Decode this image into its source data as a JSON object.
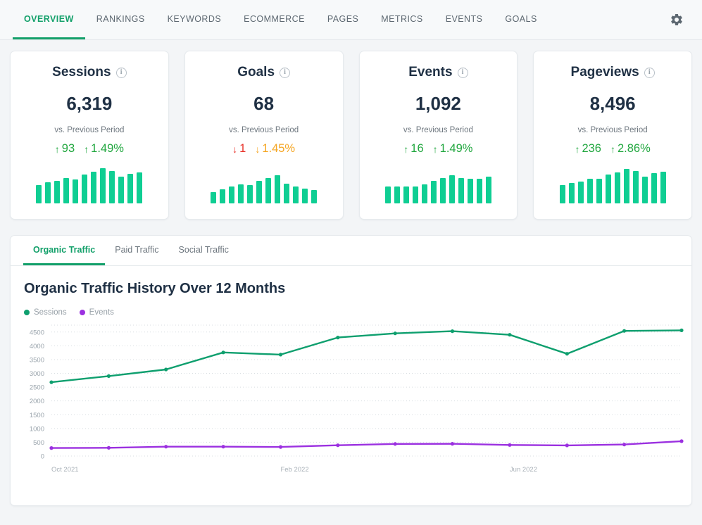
{
  "nav": {
    "tabs": [
      {
        "label": "OVERVIEW",
        "active": true
      },
      {
        "label": "RANKINGS",
        "active": false
      },
      {
        "label": "KEYWORDS",
        "active": false
      },
      {
        "label": "ECOMMERCE",
        "active": false
      },
      {
        "label": "PAGES",
        "active": false
      },
      {
        "label": "METRICS",
        "active": false
      },
      {
        "label": "EVENTS",
        "active": false
      },
      {
        "label": "GOALS",
        "active": false
      }
    ],
    "settings_icon": "gear-icon"
  },
  "colors": {
    "accent_green": "#13a06a",
    "spark_green": "#0fce93",
    "up_green": "#21a73f",
    "down_red": "#e8332a",
    "down_orange": "#f5a623",
    "sessions_line": "#0e9f6e",
    "events_line": "#9b30e0",
    "title": "#1f3044"
  },
  "cards": [
    {
      "title": "Sessions",
      "info_icon": "info-icon",
      "value": "6,319",
      "comparison_label": "vs. Previous Period",
      "delta_abs": {
        "arrow": "up",
        "text": "93",
        "color": "#21a73f"
      },
      "delta_pct": {
        "arrow": "up",
        "text": "1.49%",
        "color": "#21a73f"
      },
      "spark": [
        26,
        30,
        32,
        36,
        34,
        41,
        45,
        50,
        46,
        38,
        42,
        44
      ]
    },
    {
      "title": "Goals",
      "info_icon": "info-icon",
      "value": "68",
      "comparison_label": "vs. Previous Period",
      "delta_abs": {
        "arrow": "down",
        "text": "1",
        "color": "#e8332a"
      },
      "delta_pct": {
        "arrow": "down",
        "text": "1.45%",
        "color": "#f5a623"
      },
      "spark": [
        16,
        20,
        24,
        27,
        26,
        32,
        36,
        40,
        28,
        24,
        21,
        19
      ]
    },
    {
      "title": "Events",
      "info_icon": "info-icon",
      "value": "1,092",
      "comparison_label": "vs. Previous Period",
      "delta_abs": {
        "arrow": "up",
        "text": "16",
        "color": "#21a73f"
      },
      "delta_pct": {
        "arrow": "up",
        "text": "1.49%",
        "color": "#21a73f"
      },
      "spark": [
        24,
        24,
        24,
        24,
        27,
        32,
        36,
        40,
        36,
        35,
        35,
        38
      ]
    },
    {
      "title": "Pageviews",
      "info_icon": "info-icon",
      "value": "8,496",
      "comparison_label": "vs. Previous Period",
      "delta_abs": {
        "arrow": "up",
        "text": "236",
        "color": "#21a73f"
      },
      "delta_pct": {
        "arrow": "up",
        "text": "2.86%",
        "color": "#21a73f"
      },
      "spark": [
        26,
        29,
        31,
        35,
        35,
        41,
        44,
        49,
        46,
        38,
        43,
        45
      ]
    }
  ],
  "panel": {
    "tabs": [
      {
        "label": "Organic Traffic",
        "active": true
      },
      {
        "label": "Paid Traffic",
        "active": false
      },
      {
        "label": "Social Traffic",
        "active": false
      }
    ],
    "title": "Organic Traffic History Over 12 Months"
  },
  "chart_data": {
    "type": "line",
    "title": "Organic Traffic History Over 12 Months",
    "xlabel": "",
    "ylabel": "",
    "ylim": [
      0,
      4750
    ],
    "yticks": [
      0,
      500,
      1000,
      1500,
      2000,
      2500,
      3000,
      3500,
      4000,
      4500
    ],
    "ytick_labels": [
      "0",
      "500",
      "1000",
      "1500",
      "2000",
      "2500",
      "3000",
      "3500",
      "4000",
      "4500"
    ],
    "grid": true,
    "grid_style": "dotted",
    "legend_position": "top-left",
    "x": [
      "Oct 2021",
      "Nov 2021",
      "Dec 2021",
      "Jan 2022",
      "Feb 2022",
      "Mar 2022",
      "Apr 2022",
      "May 2022",
      "Jun 2022",
      "Jul 2022",
      "Aug 2022",
      "Sep 2022"
    ],
    "xtick_labels": [
      "Oct 2021",
      "Feb 2022",
      "Jun 2022"
    ],
    "xtick_indices": [
      0,
      4,
      8
    ],
    "series": [
      {
        "name": "Sessions",
        "color": "#0e9f6e",
        "values": [
          2680,
          2900,
          3140,
          3760,
          3680,
          4300,
          4450,
          4530,
          4400,
          3710,
          4540,
          4560
        ]
      },
      {
        "name": "Events",
        "color": "#9b30e0",
        "values": [
          290,
          300,
          340,
          340,
          330,
          390,
          440,
          445,
          400,
          385,
          420,
          540
        ]
      }
    ]
  }
}
